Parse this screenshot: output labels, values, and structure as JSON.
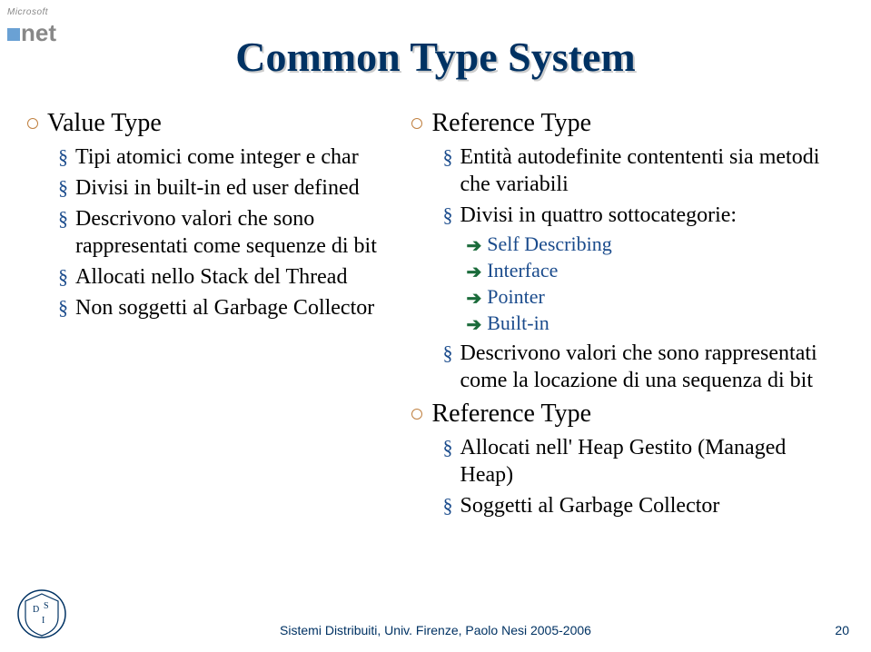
{
  "logo": {
    "brand": "Microsoft",
    "product": ".net"
  },
  "title": "Common Type System",
  "left": {
    "heading": "Value Type",
    "items": [
      "Tipi atomici come integer e char",
      "Divisi in built-in ed user defined",
      "Descrivono valori che sono rappresentati come sequenze di bit",
      "Allocati nello Stack del Thread",
      "Non soggetti al Garbage Collector"
    ]
  },
  "right": {
    "sections": [
      {
        "heading": "Reference Type",
        "items": [
          {
            "text": "Entità autodefinite contententi sia metodi che variabili"
          },
          {
            "text": "Divisi in quattro sottocategorie:",
            "sub": [
              "Self Describing",
              "Interface",
              "Pointer",
              "Built-in"
            ]
          },
          {
            "text": "Descrivono valori che sono rappresentati come la locazione di una sequenza di bit"
          }
        ]
      },
      {
        "heading": "Reference Type",
        "items": [
          {
            "text": "Allocati nell' Heap Gestito (Managed Heap)"
          },
          {
            "text": "Soggetti al Garbage Collector"
          }
        ]
      }
    ]
  },
  "footer": "Sistemi Distribuiti, Univ. Firenze, Paolo Nesi 2005-2006",
  "page": "20"
}
